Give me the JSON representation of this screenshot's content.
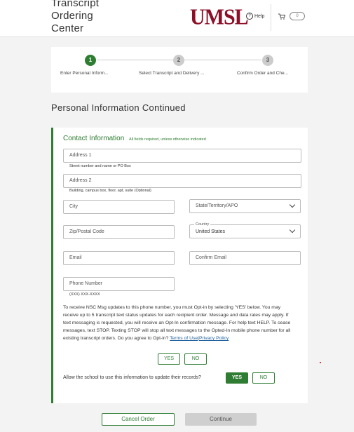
{
  "header": {
    "title_line1": "Transcript",
    "title_line2": "Ordering",
    "title_line3": "Center",
    "logo_text": "UMSL",
    "help_label": "Help",
    "cart_count": "0"
  },
  "steps": [
    {
      "number": "1",
      "label": "Enter Personal Inform...",
      "active": true
    },
    {
      "number": "2",
      "label": "Select Transcript and Delivery ...",
      "active": false
    },
    {
      "number": "3",
      "label": "Confirm Order and Che...",
      "active": false
    }
  ],
  "section_title": "Personal Information Continued",
  "contact": {
    "heading": "Contact Information",
    "required_note": "All fields required, unless otherwise indicated",
    "address1_placeholder": "Address 1",
    "address1_hint": "Street number and name or PO Box",
    "address2_placeholder": "Address 2",
    "address2_hint": "Building, campus box, floor, apt, suite (Optional)",
    "city_placeholder": "City",
    "state_placeholder": "State/Territory/APO",
    "zip_placeholder": "Zip/Postal Code",
    "country_label": "Country",
    "country_value": "United States",
    "email_placeholder": "Email",
    "confirm_email_placeholder": "Confirm Email",
    "phone_placeholder": "Phone Number",
    "phone_hint": "(XXX) XXX-XXXX",
    "optin_text": "To receive NSC Msg updates to this phone number, you must Opt-in by selecting 'YES' below. You may receive up to 5 transcript text status updates for each recipient order. Message and data rates may apply. If text messaging is requested, you will receive an Opt-In confirmation message. For help text HELP. To cease messages, text STOP. Texting STOP will stop all text messages to the Opted-In mobile phone number for all existing transcript orders. Do you agree to Opt-in?",
    "terms_link": "Terms of Use",
    "separator": "|",
    "privacy_link": "Privacy Policy",
    "optin_yes": "YES",
    "optin_no": "NO",
    "allow_question": "Allow the school to use this information to update their records?",
    "allow_yes": "YES",
    "allow_no": "NO"
  },
  "footer": {
    "cancel_label": "Cancel Order",
    "continue_label": "Continue"
  },
  "colors": {
    "brand": "#8c1028",
    "accent": "#2e7d32"
  }
}
